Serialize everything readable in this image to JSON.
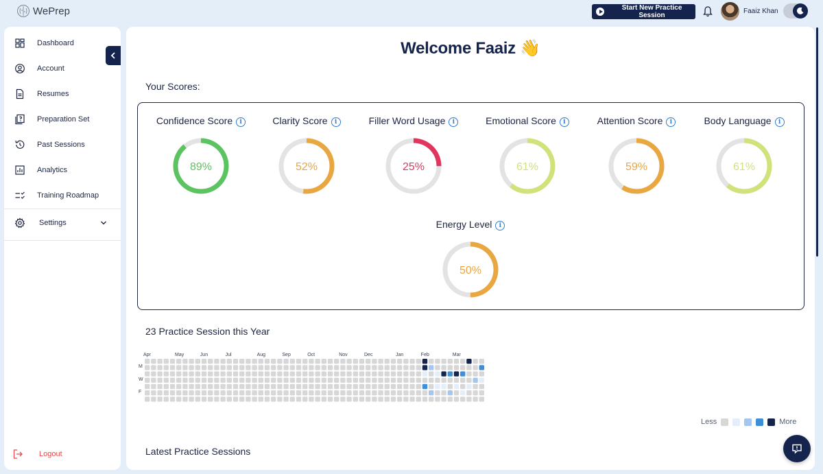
{
  "app": {
    "logo_text": "WePrep"
  },
  "header": {
    "start_button": "Start New Practice Session",
    "user_name": "Faaiz Khan"
  },
  "sidebar": {
    "items": [
      {
        "label": "Dashboard",
        "icon": "dashboard-icon"
      },
      {
        "label": "Account",
        "icon": "user-circle-icon"
      },
      {
        "label": "Resumes",
        "icon": "document-icon"
      },
      {
        "label": "Preparation Set",
        "icon": "question-doc-icon"
      },
      {
        "label": "Past Sessions",
        "icon": "history-icon"
      },
      {
        "label": "Analytics",
        "icon": "bar-chart-icon"
      },
      {
        "label": "Training Roadmap",
        "icon": "checklist-icon"
      }
    ],
    "settings_label": "Settings",
    "logout_label": "Logout"
  },
  "main": {
    "welcome": "Welcome Faaiz 👋",
    "scores_title": "Your Scores:",
    "scores": [
      {
        "name": "Confidence Score",
        "value": 89,
        "display": "89%",
        "color": "#5bc35f"
      },
      {
        "name": "Clarity Score",
        "value": 52,
        "display": "52%",
        "color": "#e9a741"
      },
      {
        "name": "Filler Word Usage",
        "value": 25,
        "display": "25%",
        "color": "#e0365d"
      },
      {
        "name": "Emotional Score",
        "value": 61,
        "display": "61%",
        "color": "#cfe37a"
      },
      {
        "name": "Attention Score",
        "value": 59,
        "display": "59%",
        "color": "#e9a741"
      },
      {
        "name": "Body Language",
        "value": 61,
        "display": "61%",
        "color": "#cfe37a"
      },
      {
        "name": "Energy Level",
        "value": 50,
        "display": "50%",
        "color": "#e9a741"
      }
    ],
    "sessions_title": "23 Practice Session this Year",
    "heatmap": {
      "months": [
        "Apr",
        "May",
        "Jun",
        "Jul",
        "Aug",
        "Sep",
        "Oct",
        "Nov",
        "Dec",
        "Jan",
        "Feb",
        "Mar"
      ],
      "days": [
        "M",
        "W",
        "F"
      ],
      "legend_less": "Less",
      "legend_more": "More",
      "level_colors": [
        "#d7d7d7",
        "#e3eefa",
        "#a3c7f0",
        "#3f8fd8",
        "#14244c"
      ],
      "active_cells": [
        {
          "week": 45,
          "day": 0,
          "level": 4
        },
        {
          "week": 45,
          "day": 1,
          "level": 4
        },
        {
          "week": 45,
          "day": 2,
          "level": 1
        },
        {
          "week": 45,
          "day": 4,
          "level": 3
        },
        {
          "week": 46,
          "day": 1,
          "level": 2
        },
        {
          "week": 46,
          "day": 5,
          "level": 2
        },
        {
          "week": 47,
          "day": 2,
          "level": 1
        },
        {
          "week": 47,
          "day": 4,
          "level": 1
        },
        {
          "week": 48,
          "day": 2,
          "level": 4
        },
        {
          "week": 48,
          "day": 4,
          "level": 1
        },
        {
          "week": 49,
          "day": 2,
          "level": 3
        },
        {
          "week": 49,
          "day": 5,
          "level": 2
        },
        {
          "week": 50,
          "day": 2,
          "level": 4
        },
        {
          "week": 50,
          "day": 4,
          "level": 1
        },
        {
          "week": 51,
          "day": 2,
          "level": 3
        },
        {
          "week": 51,
          "day": 5,
          "level": 1
        },
        {
          "week": 52,
          "day": 0,
          "level": 4
        },
        {
          "week": 52,
          "day": 4,
          "level": 1
        },
        {
          "week": 53,
          "day": 3,
          "level": 2
        },
        {
          "week": 54,
          "day": 1,
          "level": 3
        },
        {
          "week": 54,
          "day": 3,
          "level": 1
        }
      ]
    },
    "latest_title": "Latest Practice Sessions"
  }
}
